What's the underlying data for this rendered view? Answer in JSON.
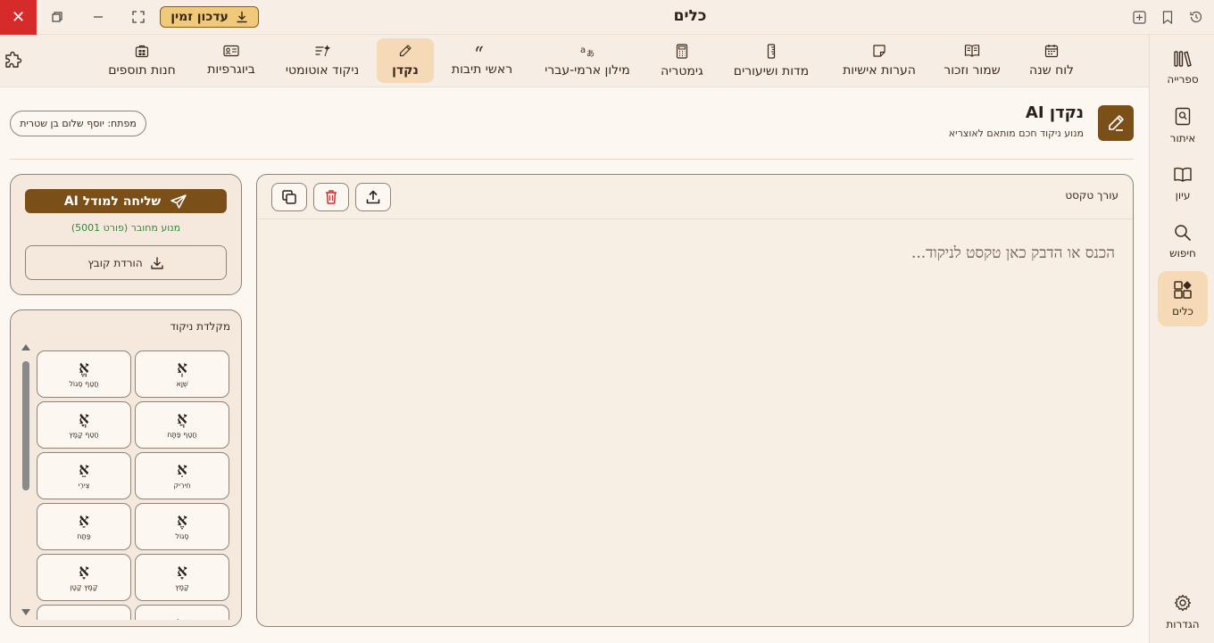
{
  "titlebar": {
    "title": "כלים",
    "update_label": "עדכון זמין"
  },
  "toolbar": {
    "tools": [
      {
        "label": "לוח שנה",
        "icon": "calendar-icon"
      },
      {
        "label": "שמור וזכור",
        "icon": "open-book-icon"
      },
      {
        "label": "הערות אישיות",
        "icon": "sticky-note-icon"
      },
      {
        "label": "מדות ושיעורים",
        "icon": "ruler-icon"
      },
      {
        "label": "גימטריה",
        "icon": "calculator-icon"
      },
      {
        "label": "מילון ארמי-עברי",
        "icon": "translate-icon"
      },
      {
        "label": "ראשי תיבות",
        "icon": "quote-icon"
      },
      {
        "label": "נקדן",
        "icon": "pencil-icon"
      },
      {
        "label": "ניקוד אוטומטי",
        "icon": "auto-text-icon"
      },
      {
        "label": "ביוגרפיות",
        "icon": "id-card-icon"
      },
      {
        "label": "חנות תוספים",
        "icon": "store-icon"
      }
    ]
  },
  "sidebar": {
    "items": [
      {
        "label": "ספרייה",
        "icon": "library-icon"
      },
      {
        "label": "איתור",
        "icon": "locate-book-icon"
      },
      {
        "label": "עיון",
        "icon": "reading-book-icon"
      },
      {
        "label": "חיפוש",
        "icon": "search-icon"
      },
      {
        "label": "כלים",
        "icon": "tools-grid-icon"
      }
    ],
    "settings_label": "הגדרות"
  },
  "header": {
    "title": "נקדן AI",
    "subtitle": "מנוע ניקוד חכם מותאם לאוצריא",
    "key_label": "מפתח: יוסף שלום בן שטרית"
  },
  "editor": {
    "label": "עורך טקסט",
    "placeholder": "הכנס או הדבק כאן טקסט לניקוד..."
  },
  "send_panel": {
    "send_label": "שליחה למודל AI",
    "engine_status": "מנוע מחובר (פורט 5001)",
    "download_label": "הורדת קובץ"
  },
  "keyboard": {
    "title": "מקלדת ניקוד",
    "keys": [
      {
        "glyph": "אְ",
        "name": "שְׁוָא"
      },
      {
        "glyph": "אֱ",
        "name": "חֲטַף סֶגוֹל"
      },
      {
        "glyph": "אֲ",
        "name": "חֲטַף פַּתָּח"
      },
      {
        "glyph": "אֳ",
        "name": "חֲטַף קָמָץ"
      },
      {
        "glyph": "אִ",
        "name": "חִירִיק"
      },
      {
        "glyph": "אֵ",
        "name": "צֵירֵי"
      },
      {
        "glyph": "אֶ",
        "name": "סֶגוֹל"
      },
      {
        "glyph": "אַ",
        "name": "פַּתַח"
      },
      {
        "glyph": "אָ",
        "name": "קָמָץ"
      },
      {
        "glyph": "אָ",
        "name": "קָמָץ קָטָן"
      },
      {
        "glyph": "אֹ",
        "name": ""
      },
      {
        "glyph": "אֻ",
        "name": ""
      }
    ]
  },
  "colors": {
    "accent": "#7a4f18",
    "active_tab": "#f6d9b6",
    "close": "#d62b2b",
    "update_badge": "#f0c97a",
    "status_ok": "#2e8b3a"
  }
}
